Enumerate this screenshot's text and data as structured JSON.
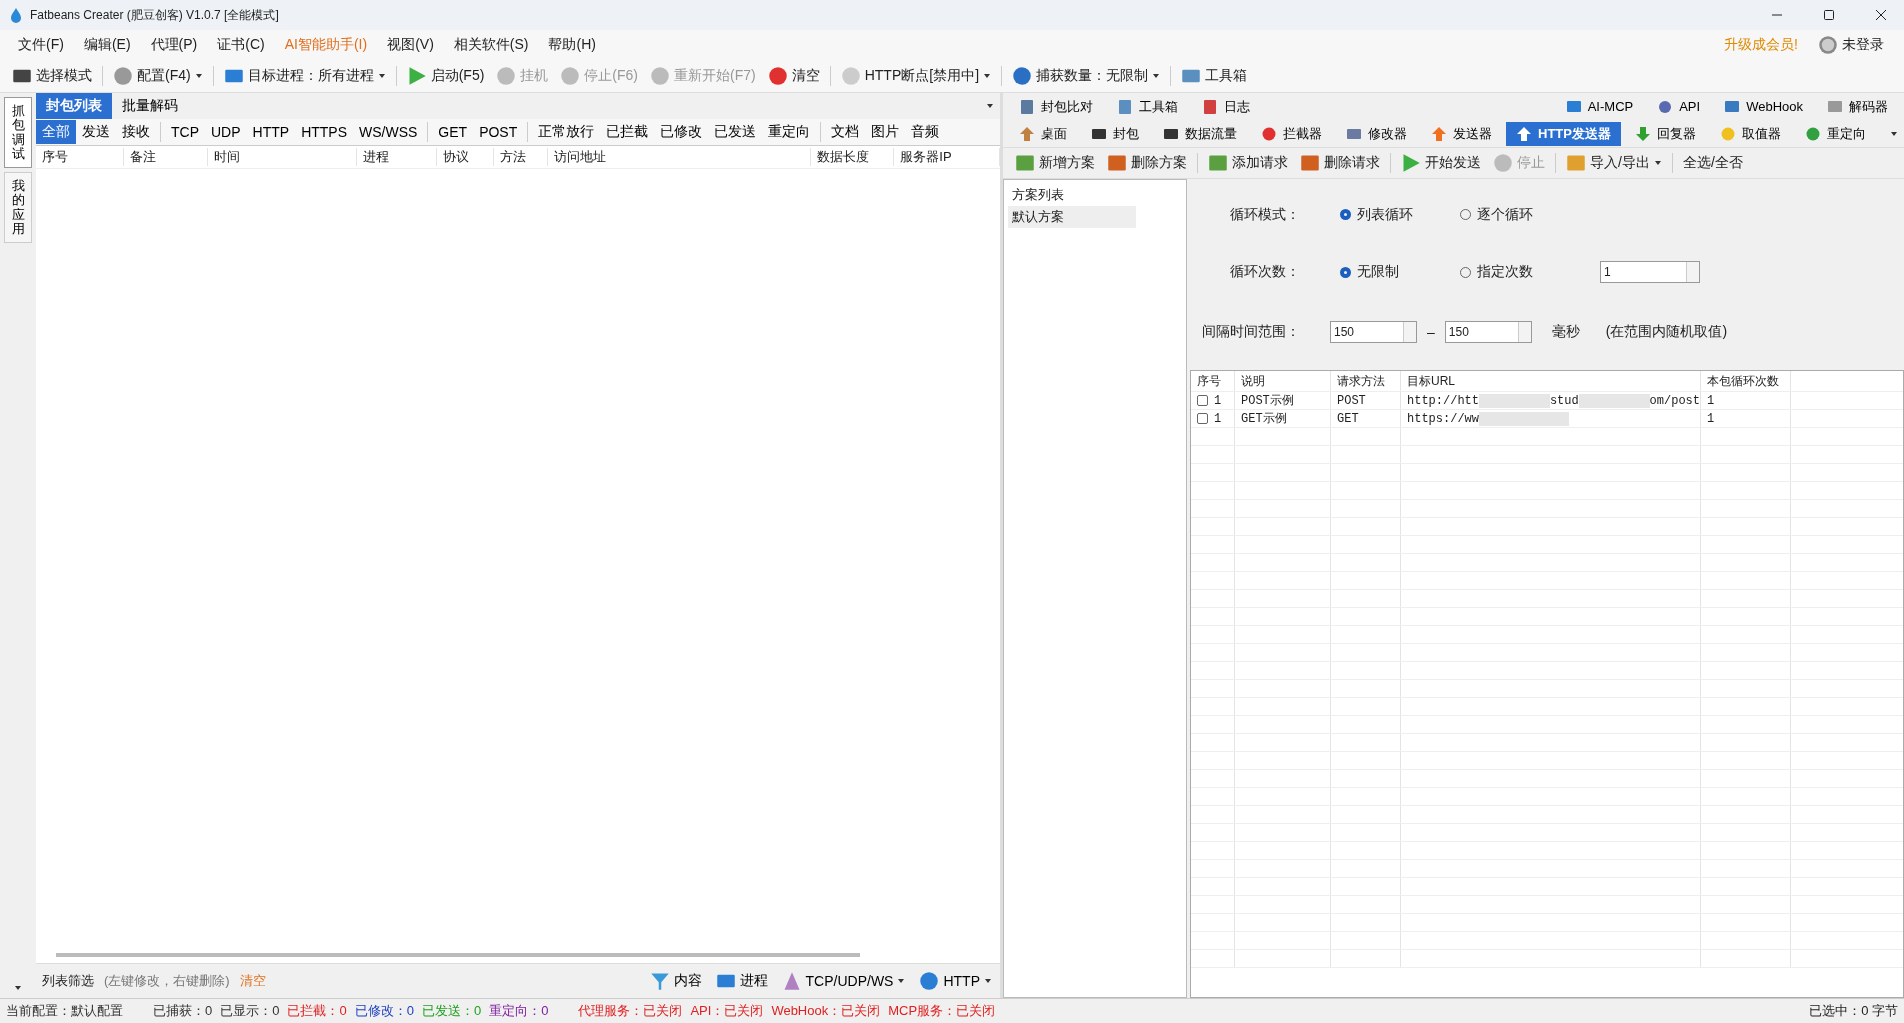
{
  "window": {
    "title": "Fatbeans Creater (肥豆创客) V1.0.7 [全能模式]"
  },
  "menu": [
    {
      "label": "文件(F)",
      "highlight": false
    },
    {
      "label": "编辑(E)",
      "highlight": false
    },
    {
      "label": "代理(P)",
      "highlight": false
    },
    {
      "label": "证书(C)",
      "highlight": false
    },
    {
      "label": "AI智能助手(I)",
      "highlight": true
    },
    {
      "label": "视图(V)",
      "highlight": false
    },
    {
      "label": "相关软件(S)",
      "highlight": false
    },
    {
      "label": "帮助(H)",
      "highlight": false
    }
  ],
  "upgrade_link": "升级成会员!",
  "account": "未登录",
  "toolbar": [
    {
      "label": "选择模式",
      "disabled": false,
      "dropdown": false
    },
    {
      "label": "配置(F4)",
      "disabled": false,
      "dropdown": true
    },
    {
      "label": "目标进程：所有进程",
      "disabled": false,
      "dropdown": true
    },
    {
      "label": "启动(F5)",
      "disabled": false,
      "dropdown": false
    },
    {
      "label": "挂机",
      "disabled": true,
      "dropdown": false
    },
    {
      "label": "停止(F6)",
      "disabled": true,
      "dropdown": false
    },
    {
      "label": "重新开始(F7)",
      "disabled": true,
      "dropdown": false
    },
    {
      "label": "清空",
      "disabled": false,
      "dropdown": false
    },
    {
      "label": "HTTP断点[禁用中]",
      "disabled": false,
      "dropdown": true
    },
    {
      "label": "捕获数量：无限制",
      "disabled": false,
      "dropdown": true
    },
    {
      "label": "工具箱",
      "disabled": false,
      "dropdown": false
    }
  ],
  "side_tabs": [
    {
      "label": "抓包调试",
      "selected": true
    },
    {
      "label": "我的应用",
      "selected": false
    }
  ],
  "left_tabs": [
    {
      "label": "封包列表",
      "selected": true
    },
    {
      "label": "批量解码",
      "selected": false
    }
  ],
  "filters": [
    [
      {
        "label": "全部",
        "selected": true
      },
      {
        "label": "发送",
        "selected": false
      },
      {
        "label": "接收",
        "selected": false
      }
    ],
    [
      {
        "label": "TCP",
        "selected": false
      },
      {
        "label": "UDP",
        "selected": false
      },
      {
        "label": "HTTP",
        "selected": false
      },
      {
        "label": "HTTPS",
        "selected": false
      },
      {
        "label": "WS/WSS",
        "selected": false
      }
    ],
    [
      {
        "label": "GET",
        "selected": false
      },
      {
        "label": "POST",
        "selected": false
      }
    ],
    [
      {
        "label": "正常放行",
        "selected": false
      },
      {
        "label": "已拦截",
        "selected": false
      },
      {
        "label": "已修改",
        "selected": false
      },
      {
        "label": "已发送",
        "selected": false
      },
      {
        "label": "重定向",
        "selected": false
      }
    ],
    [
      {
        "label": "文档",
        "selected": false
      },
      {
        "label": "图片",
        "selected": false
      },
      {
        "label": "音频",
        "selected": false
      }
    ]
  ],
  "packet_columns": [
    "序号",
    "备注",
    "时间",
    "进程",
    "协议",
    "方法",
    "访问地址",
    "数据长度",
    "服务器IP"
  ],
  "filter_bar": {
    "label": "列表筛选",
    "hint": "(左键修改，右键删除)",
    "clear": "清空",
    "buttons": [
      {
        "label": "内容",
        "dropdown": false
      },
      {
        "label": "进程",
        "dropdown": false
      },
      {
        "label": "TCP/UDP/WS",
        "dropdown": true
      },
      {
        "label": "HTTP",
        "dropdown": true
      }
    ]
  },
  "tools_left": [
    "封包比对",
    "工具箱",
    "日志"
  ],
  "tools_right": [
    "AI-MCP",
    "API",
    "WebHook",
    "解码器"
  ],
  "modules": [
    {
      "label": "桌面",
      "selected": false
    },
    {
      "label": "封包",
      "selected": false
    },
    {
      "label": "数据流量",
      "selected": false
    },
    {
      "label": "拦截器",
      "selected": false
    },
    {
      "label": "修改器",
      "selected": false
    },
    {
      "label": "发送器",
      "selected": false
    },
    {
      "label": "HTTP发送器",
      "selected": true
    },
    {
      "label": "回复器",
      "selected": false
    },
    {
      "label": "取值器",
      "selected": false
    },
    {
      "label": "重定向",
      "selected": false
    }
  ],
  "sender_toolbar": [
    {
      "label": "新增方案",
      "disabled": false,
      "dropdown": false
    },
    {
      "label": "删除方案",
      "disabled": false,
      "dropdown": false
    },
    {
      "label": "添加请求",
      "disabled": false,
      "dropdown": false
    },
    {
      "label": "删除请求",
      "disabled": false,
      "dropdown": false
    },
    {
      "label": "开始发送",
      "disabled": false,
      "dropdown": false
    },
    {
      "label": "停止",
      "disabled": true,
      "dropdown": false
    },
    {
      "label": "导入/导出",
      "disabled": false,
      "dropdown": true
    },
    {
      "label": "全选/全否",
      "disabled": false,
      "dropdown": false
    }
  ],
  "schemes": {
    "header": "方案列表",
    "items": [
      {
        "label": "默认方案",
        "selected": true
      }
    ]
  },
  "loop_mode": {
    "label": "循环模式：",
    "options": [
      {
        "label": "列表循环",
        "selected": true
      },
      {
        "label": "逐个循环",
        "selected": false
      }
    ]
  },
  "loop_count": {
    "label": "循环次数：",
    "options": [
      {
        "label": "无限制",
        "selected": true
      },
      {
        "label": "指定次数",
        "selected": false
      }
    ],
    "value": "1"
  },
  "interval": {
    "label": "间隔时间范围：",
    "min": "150",
    "separator": "–",
    "max": "150",
    "unit": "毫秒",
    "note": "(在范围内随机取值)"
  },
  "requests": {
    "columns": [
      "序号",
      "说明",
      "请求方法",
      "目标URL",
      "本包循环次数"
    ],
    "rows": [
      {
        "checked": false,
        "index": "1",
        "desc": "POST示例",
        "method": "POST",
        "url_parts": [
          "http://htt",
          "stud",
          "om/post"
        ],
        "count": "1"
      },
      {
        "checked": false,
        "index": "1",
        "desc": "GET示例",
        "method": "GET",
        "url_parts": [
          "https://ww"
        ],
        "count": "1"
      }
    ]
  },
  "status": [
    {
      "text": "当前配置：默认配置",
      "color": "#333333"
    },
    {
      "text": "已捕获：0",
      "color": "#333333"
    },
    {
      "text": "已显示：0",
      "color": "#333333"
    },
    {
      "text": "已拦截：0",
      "color": "#e02020"
    },
    {
      "text": "已修改：0",
      "color": "#2040c0"
    },
    {
      "text": "已发送：0",
      "color": "#20a020"
    },
    {
      "text": "重定向：0",
      "color": "#8020a0"
    },
    {
      "text": "代理服务：已关闭",
      "color": "#e02020"
    },
    {
      "text": "API：已关闭",
      "color": "#e02020"
    },
    {
      "text": "WebHook：已关闭",
      "color": "#e02020"
    },
    {
      "text": "MCP服务：已关闭",
      "color": "#e02020"
    }
  ],
  "selected_bytes": "已选中：0 字节"
}
